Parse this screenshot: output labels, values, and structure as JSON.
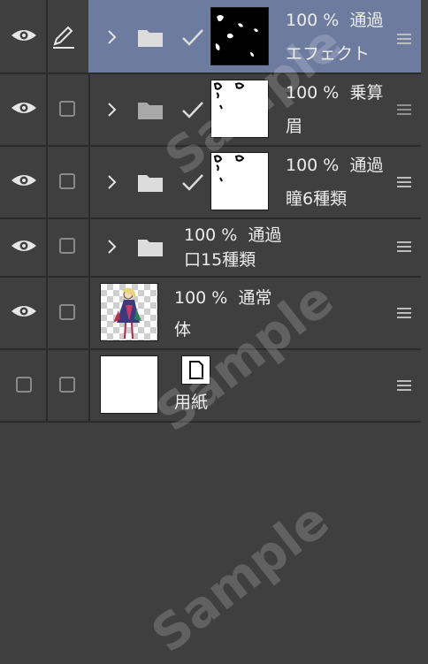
{
  "watermark": "Sample",
  "layers": [
    {
      "opacity": "100 %",
      "blend": "通過",
      "name": "エフェクト"
    },
    {
      "opacity": "100 %",
      "blend": "乗算",
      "name": "眉"
    },
    {
      "opacity": "100 %",
      "blend": "通過",
      "name": "瞳6種類"
    },
    {
      "opacity": "100 %",
      "blend": "通過",
      "name": "口15種類"
    },
    {
      "opacity": "100 %",
      "blend": "通常",
      "name": "体"
    },
    {
      "name": "用紙"
    }
  ],
  "colors": {
    "background": "#3f3f3f",
    "selected": "#6c7b9e",
    "divider": "#2b2b2b"
  }
}
